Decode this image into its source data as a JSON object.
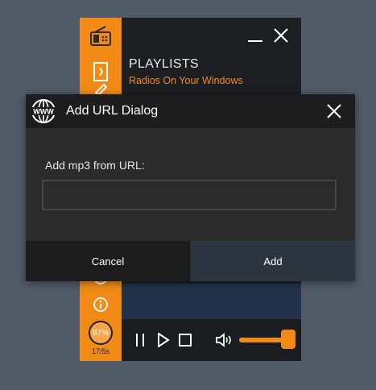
{
  "player": {
    "header": {
      "title": "PLAYLISTS",
      "subtitle": "Radios On Your Windows"
    },
    "sidebar_icons": [
      "radio-icon",
      "playlist-icon",
      "edit-icon",
      "info-icon",
      "info-icon"
    ],
    "progress": {
      "percent_label": "87%",
      "percent_value": 0.87,
      "time_label": "17/5s"
    },
    "volume_level": 0.9,
    "accent_color": "#f28b16"
  },
  "dialog": {
    "title": "Add URL Dialog",
    "field_label": "Add mp3 from URL:",
    "url_value": "",
    "url_placeholder": "",
    "cancel_label": "Cancel",
    "add_label": "Add"
  }
}
